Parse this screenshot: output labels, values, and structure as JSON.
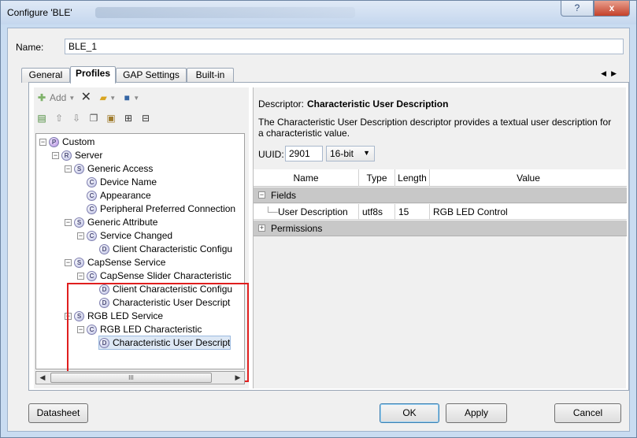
{
  "window": {
    "title": "Configure 'BLE'",
    "help_symbol": "?",
    "close_symbol": "x"
  },
  "name_field": {
    "label": "Name:",
    "value": "BLE_1"
  },
  "tabs": [
    {
      "label": "General"
    },
    {
      "label": "Profiles"
    },
    {
      "label": "GAP Settings"
    },
    {
      "label": "Built-in"
    }
  ],
  "tab_scroll": {
    "left": "◀",
    "right": "▶"
  },
  "toolbar": {
    "add_label": "Add"
  },
  "tree": {
    "nodes": [
      {
        "badge": "P",
        "label": "Custom"
      },
      {
        "badge": "R",
        "label": "Server"
      },
      {
        "badge": "S",
        "label": "Generic Access"
      },
      {
        "badge": "C",
        "label": "Device Name"
      },
      {
        "badge": "C",
        "label": "Appearance"
      },
      {
        "badge": "C",
        "label": "Peripheral Preferred Connection"
      },
      {
        "badge": "S",
        "label": "Generic Attribute"
      },
      {
        "badge": "C",
        "label": "Service Changed"
      },
      {
        "badge": "D",
        "label": "Client Characteristic Configu"
      },
      {
        "badge": "S",
        "label": "CapSense Service"
      },
      {
        "badge": "C",
        "label": "CapSense Slider Characteristic"
      },
      {
        "badge": "D",
        "label": "Client Characteristic Configu"
      },
      {
        "badge": "D",
        "label": "Characteristic User Descript"
      },
      {
        "badge": "S",
        "label": "RGB LED Service"
      },
      {
        "badge": "C",
        "label": "RGB LED Characteristic"
      },
      {
        "badge": "D",
        "label": "Characteristic User Descript"
      }
    ],
    "scroll_thumb": "III"
  },
  "descriptor": {
    "prefix": "Descriptor:",
    "name": "Characteristic User Description",
    "description": "The Characteristic User Description descriptor provides a textual user description for a characteristic value.",
    "uuid_label": "UUID:",
    "uuid_value": "2901",
    "uuid_size": "16-bit"
  },
  "grid": {
    "headers": [
      "Name",
      "Type",
      "Length",
      "Value"
    ],
    "fields_label": "Fields",
    "rows": [
      {
        "name": "User Description",
        "type": "utf8s",
        "length": "15",
        "value": "RGB LED Control"
      }
    ],
    "permissions_label": "Permissions"
  },
  "buttons": {
    "datasheet": "Datasheet",
    "ok": "OK",
    "apply": "Apply",
    "cancel": "Cancel"
  },
  "colors": {
    "highlight": "#e01e1e",
    "category_row": "#c8c8c8"
  }
}
